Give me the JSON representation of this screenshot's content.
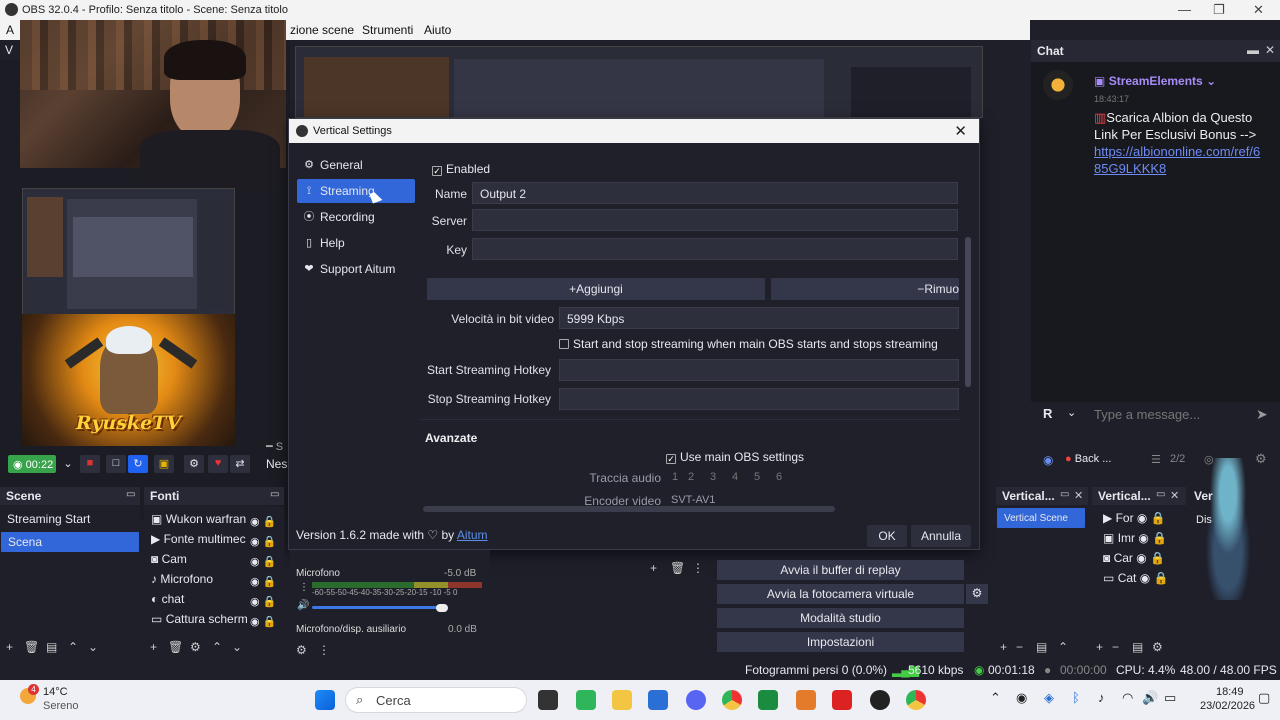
{
  "window": {
    "title": "OBS 32.0.4 - Profilo: Senza titolo - Scene: Senza titolo"
  },
  "menu": {
    "left_fragment": "A",
    "items": [
      "zione scene",
      "Strumenti",
      "Aiuto"
    ],
    "side_fragment": "V"
  },
  "preview": {
    "logo_text": "RyuskeTV",
    "rec_time": "00:22",
    "next_fragment": "Nes",
    "s_fragment": "S"
  },
  "dialog": {
    "title": "Vertical Settings",
    "nav": [
      {
        "label": "General",
        "icon": "gear-icon",
        "selected": false
      },
      {
        "label": "Streaming",
        "icon": "broadcast-icon",
        "selected": true
      },
      {
        "label": "Recording",
        "icon": "record-icon",
        "selected": false
      },
      {
        "label": "Help",
        "icon": "help-icon",
        "selected": false
      },
      {
        "label": "Support Aitum",
        "icon": "heart-icon",
        "selected": false
      }
    ],
    "enabled_label": "Enabled",
    "enabled_checked": true,
    "name_label": "Name",
    "name_value": "Output 2",
    "server_label": "Server",
    "server_value": "",
    "key_label": "Key",
    "key_value": "",
    "add_button": "Aggiungi",
    "remove_button": "Rimuo",
    "bitrate_label": "Velocità in bit video",
    "bitrate_value": "5999 Kbps",
    "autostart_label": "Start and stop streaming when main OBS starts and stops streaming",
    "autostart_checked": false,
    "start_hotkey_label": "Start Streaming Hotkey",
    "stop_hotkey_label": "Stop Streaming Hotkey",
    "advanced_section": "Avanzate",
    "use_main_label": "Use main OBS settings",
    "use_main_checked": true,
    "audio_track_label": "Traccia audio",
    "audio_tracks": [
      "1",
      "2",
      "3",
      "4",
      "5",
      "6"
    ],
    "encoder_label": "Encoder video",
    "encoder_value": "SVT-AV1",
    "version_text": "Version 1.6.2 made with ♡ by",
    "version_link": "Aitum",
    "ok_button": "OK",
    "cancel_button": "Annulla"
  },
  "chat": {
    "header": "Chat",
    "author": "StreamElements",
    "time": "18:43:17",
    "message": "Scarica Albion da Questo Link Per Esclusivi Bonus -->",
    "link": "https://albiononline.com/ref/685G9LKKK8",
    "input_placeholder": "Type a message...",
    "user_initial": "R",
    "back_label": "Back ...",
    "page_counter": "2/2",
    "side_fragment": "Dis"
  },
  "docks": {
    "scene_header": "Scene",
    "scenes": [
      "Streaming Start",
      "Scena"
    ],
    "sources_header": "Fonti",
    "sources": [
      "Wukon warfran",
      "Fonte multimec",
      "Cam",
      "Microfono",
      "chat",
      "Cattura scherm"
    ],
    "mixer": [
      {
        "name": "Microfono",
        "db": "-5.0 dB"
      },
      {
        "name": "Microfono/disp. ausiliario",
        "db": "0.0 dB"
      }
    ],
    "scale": "-60-55-50-45-40-35-30-25-20-15 -10 -5  0",
    "controls": [
      "Avvia il buffer di replay",
      "Avvia la fotocamera virtuale",
      "Modalità studio",
      "Impostazioni"
    ],
    "vertical_scene_header": "Vertical...",
    "vertical_scenes": [
      "Vertical Scene"
    ],
    "vertical_sources_header": "Vertical...",
    "vertical_sources": [
      "For",
      "Imr",
      "Car",
      "Cat"
    ],
    "ver_fragment": "Ver"
  },
  "status": {
    "dropped": "Fotogrammi persi 0 (0.0%)",
    "bitrate": "5610 kbps",
    "live_time": "00:01:18",
    "rec_time": "00:00:00",
    "cpu": "CPU: 4.4%",
    "fps": "48.00 / 48.00 FPS"
  },
  "taskbar": {
    "temp": "14°C",
    "weather": "Sereno",
    "badge": "4",
    "search_placeholder": "Cerca",
    "time": "18:49",
    "date": "23/02/2026"
  },
  "colors": {
    "accent": "#3267d9",
    "record_green": "#37a34a",
    "bg": "#1e1f29",
    "link": "#6f8bf4"
  }
}
